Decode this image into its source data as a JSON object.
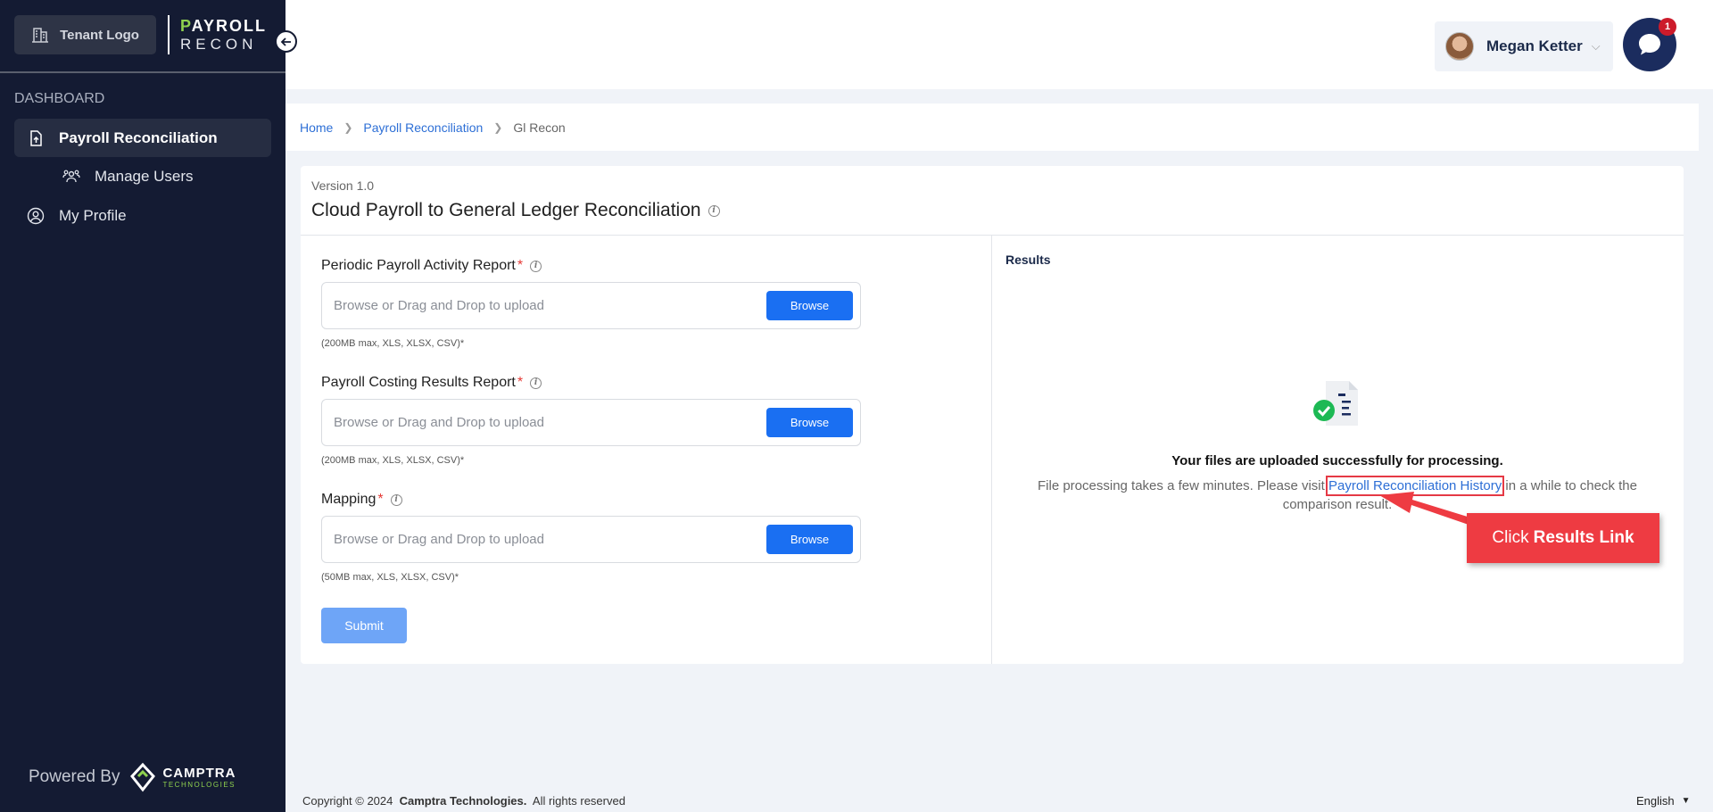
{
  "brand": {
    "tenant_logo": "Tenant Logo",
    "app_logo_top": "AYROLL",
    "app_logo_top_initial": "P",
    "app_logo_bottom": "RECON"
  },
  "sidebar": {
    "section_label": "DASHBOARD",
    "items": [
      {
        "label": "Payroll Reconciliation",
        "icon": "upload-file-icon",
        "active": true
      },
      {
        "label": "Manage Users",
        "icon": "users-icon",
        "active": false
      },
      {
        "label": "My Profile",
        "icon": "user-circle-icon",
        "active": false
      }
    ],
    "powered_by": "Powered By",
    "company_logo_name": "CAMPTRA",
    "company_logo_sub": "TECHNOLOGIES"
  },
  "header": {
    "user_name": "Megan Ketter",
    "chat_badge": "1"
  },
  "breadcrumb": {
    "home": "Home",
    "parent": "Payroll Reconciliation",
    "current": "Gl Recon"
  },
  "form": {
    "version": "Version 1.0",
    "title": "Cloud Payroll to General Ledger Reconciliation",
    "fields": [
      {
        "label": "Periodic Payroll Activity Report",
        "placeholder": "Browse or Drag and Drop to upload",
        "button": "Browse",
        "hint": "(200MB max, XLS, XLSX, CSV)*"
      },
      {
        "label": "Payroll Costing Results Report",
        "placeholder": "Browse or Drag and Drop to upload",
        "button": "Browse",
        "hint": "(200MB max, XLS, XLSX, CSV)*"
      },
      {
        "label": "Mapping",
        "placeholder": "Browse or Drag and Drop to upload",
        "button": "Browse",
        "hint": "(50MB max, XLS, XLSX, CSV)*"
      }
    ],
    "required_mark": "*",
    "submit": "Submit"
  },
  "results": {
    "title": "Results",
    "success": "Your files are uploaded successfully for processing.",
    "sub_before": "File processing takes a few minutes. Please visit ",
    "link": "Payroll Reconciliation History",
    "sub_after": " in a while to check the comparison result."
  },
  "annotation": {
    "prefix": "Click",
    "emphasis": "Results Link"
  },
  "footer": {
    "copyright": "Copyright © 2024",
    "company": "Camptra Technologies.",
    "rights": "All rights reserved",
    "language": "English"
  },
  "colors": {
    "sidebar": "#141b33",
    "accent": "#1a6ff2",
    "link": "#2d6fd6",
    "required": "#e53935",
    "callout": "#ee3b42",
    "brand_green": "#8fd14f"
  }
}
